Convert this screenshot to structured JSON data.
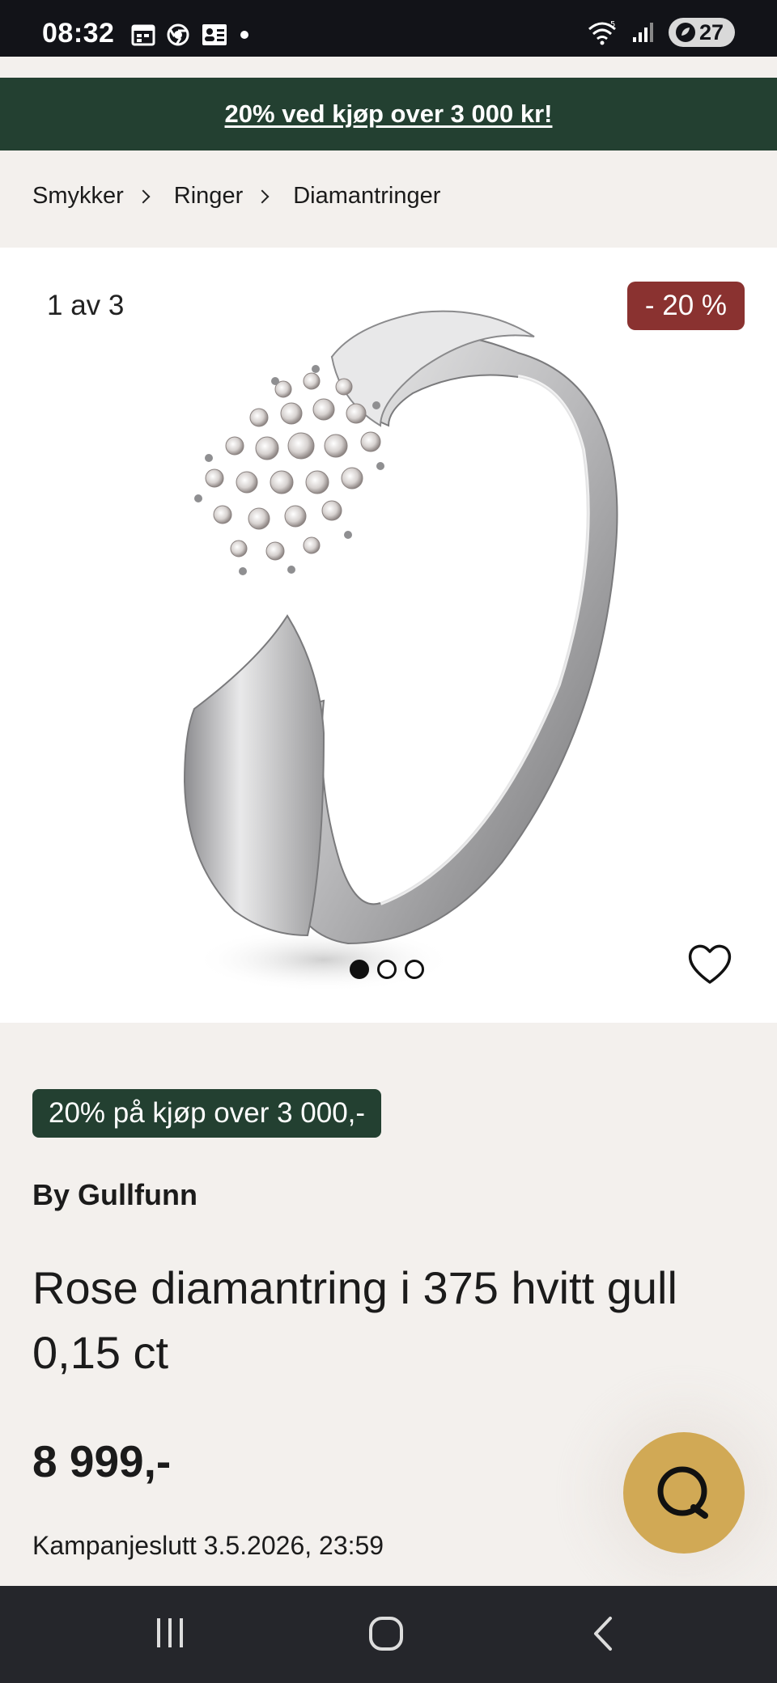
{
  "status_bar": {
    "time": "08:32",
    "battery_level": "27",
    "icons": [
      "calendar-icon",
      "chrome-icon",
      "contacts-icon",
      "notification-dot-icon",
      "wifi-icon",
      "signal-icon",
      "battery-icon"
    ]
  },
  "promo_banner": {
    "text": "20% ved kjøp over 3 000 kr!"
  },
  "breadcrumb": {
    "items": [
      "Smykker",
      "Ringer",
      "Diamantringer"
    ]
  },
  "gallery": {
    "counter": "1 av 3",
    "discount_badge": "- 20 %",
    "current_image": 1,
    "total_images": 3
  },
  "product": {
    "promo_tag": "20% på kjøp over 3 000,-",
    "brand": "By Gullfunn",
    "title": "Rose diamantring i 375 hvitt gull 0,15 ct",
    "price": "8 999,-",
    "campaign_end": "Kampanjeslutt 3.5.2026, 23:59"
  },
  "colors": {
    "brand_green": "#234031",
    "discount_red": "#8a3230",
    "chat_gold": "#d1a955",
    "page_bg": "#f3f0ed"
  },
  "nav_bar": {
    "buttons": [
      "recent-apps-icon",
      "home-icon",
      "back-icon"
    ]
  }
}
